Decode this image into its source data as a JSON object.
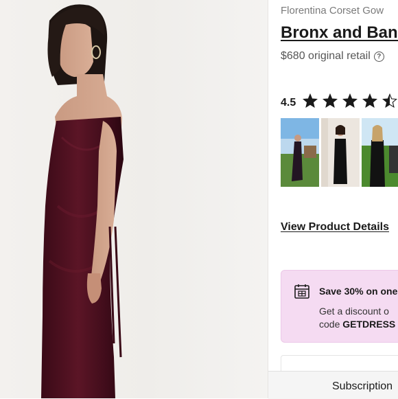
{
  "product": {
    "subtitle": "Florentina Corset Gow",
    "brand": "Bronx and Banc",
    "price": "$680 original retail",
    "help_icon": "question-circle-icon"
  },
  "rating": {
    "value": "4.5",
    "stars": 4.5,
    "max": 5,
    "star_color": "#1a1a1a"
  },
  "reviews": {
    "photos": [
      "customer-photo-1",
      "customer-photo-2",
      "customer-photo-3"
    ],
    "nav_icon": "chevron-left-icon"
  },
  "details_link": "View Product Details",
  "promo": {
    "icon": "calendar-icon",
    "title": "Save 30% on one",
    "line1": "Get a discount o",
    "line2_prefix": "code ",
    "code": "GETDRESS",
    "background": "#f5dbf2"
  },
  "subscription_bar": {
    "label": "Subscription"
  }
}
